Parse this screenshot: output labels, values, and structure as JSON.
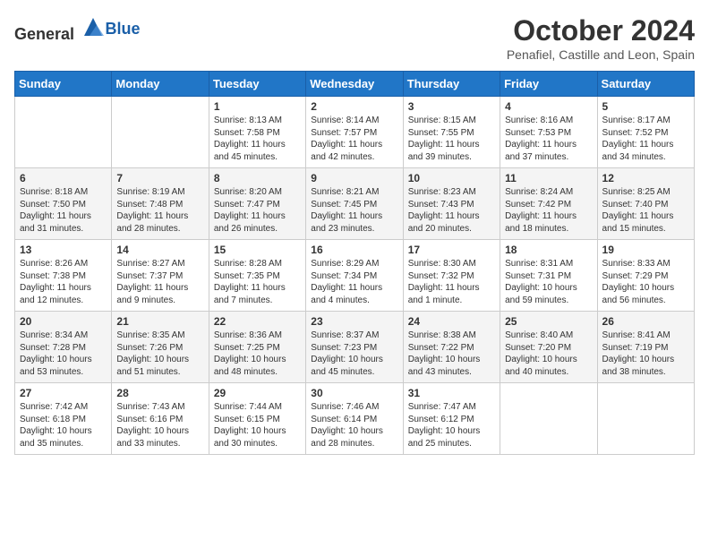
{
  "header": {
    "logo_general": "General",
    "logo_blue": "Blue",
    "main_title": "October 2024",
    "subtitle": "Penafiel, Castille and Leon, Spain"
  },
  "calendar": {
    "days_of_week": [
      "Sunday",
      "Monday",
      "Tuesday",
      "Wednesday",
      "Thursday",
      "Friday",
      "Saturday"
    ],
    "weeks": [
      [
        {
          "day": "",
          "content": ""
        },
        {
          "day": "",
          "content": ""
        },
        {
          "day": "1",
          "content": "Sunrise: 8:13 AM\nSunset: 7:58 PM\nDaylight: 11 hours and 45 minutes."
        },
        {
          "day": "2",
          "content": "Sunrise: 8:14 AM\nSunset: 7:57 PM\nDaylight: 11 hours and 42 minutes."
        },
        {
          "day": "3",
          "content": "Sunrise: 8:15 AM\nSunset: 7:55 PM\nDaylight: 11 hours and 39 minutes."
        },
        {
          "day": "4",
          "content": "Sunrise: 8:16 AM\nSunset: 7:53 PM\nDaylight: 11 hours and 37 minutes."
        },
        {
          "day": "5",
          "content": "Sunrise: 8:17 AM\nSunset: 7:52 PM\nDaylight: 11 hours and 34 minutes."
        }
      ],
      [
        {
          "day": "6",
          "content": "Sunrise: 8:18 AM\nSunset: 7:50 PM\nDaylight: 11 hours and 31 minutes."
        },
        {
          "day": "7",
          "content": "Sunrise: 8:19 AM\nSunset: 7:48 PM\nDaylight: 11 hours and 28 minutes."
        },
        {
          "day": "8",
          "content": "Sunrise: 8:20 AM\nSunset: 7:47 PM\nDaylight: 11 hours and 26 minutes."
        },
        {
          "day": "9",
          "content": "Sunrise: 8:21 AM\nSunset: 7:45 PM\nDaylight: 11 hours and 23 minutes."
        },
        {
          "day": "10",
          "content": "Sunrise: 8:23 AM\nSunset: 7:43 PM\nDaylight: 11 hours and 20 minutes."
        },
        {
          "day": "11",
          "content": "Sunrise: 8:24 AM\nSunset: 7:42 PM\nDaylight: 11 hours and 18 minutes."
        },
        {
          "day": "12",
          "content": "Sunrise: 8:25 AM\nSunset: 7:40 PM\nDaylight: 11 hours and 15 minutes."
        }
      ],
      [
        {
          "day": "13",
          "content": "Sunrise: 8:26 AM\nSunset: 7:38 PM\nDaylight: 11 hours and 12 minutes."
        },
        {
          "day": "14",
          "content": "Sunrise: 8:27 AM\nSunset: 7:37 PM\nDaylight: 11 hours and 9 minutes."
        },
        {
          "day": "15",
          "content": "Sunrise: 8:28 AM\nSunset: 7:35 PM\nDaylight: 11 hours and 7 minutes."
        },
        {
          "day": "16",
          "content": "Sunrise: 8:29 AM\nSunset: 7:34 PM\nDaylight: 11 hours and 4 minutes."
        },
        {
          "day": "17",
          "content": "Sunrise: 8:30 AM\nSunset: 7:32 PM\nDaylight: 11 hours and 1 minute."
        },
        {
          "day": "18",
          "content": "Sunrise: 8:31 AM\nSunset: 7:31 PM\nDaylight: 10 hours and 59 minutes."
        },
        {
          "day": "19",
          "content": "Sunrise: 8:33 AM\nSunset: 7:29 PM\nDaylight: 10 hours and 56 minutes."
        }
      ],
      [
        {
          "day": "20",
          "content": "Sunrise: 8:34 AM\nSunset: 7:28 PM\nDaylight: 10 hours and 53 minutes."
        },
        {
          "day": "21",
          "content": "Sunrise: 8:35 AM\nSunset: 7:26 PM\nDaylight: 10 hours and 51 minutes."
        },
        {
          "day": "22",
          "content": "Sunrise: 8:36 AM\nSunset: 7:25 PM\nDaylight: 10 hours and 48 minutes."
        },
        {
          "day": "23",
          "content": "Sunrise: 8:37 AM\nSunset: 7:23 PM\nDaylight: 10 hours and 45 minutes."
        },
        {
          "day": "24",
          "content": "Sunrise: 8:38 AM\nSunset: 7:22 PM\nDaylight: 10 hours and 43 minutes."
        },
        {
          "day": "25",
          "content": "Sunrise: 8:40 AM\nSunset: 7:20 PM\nDaylight: 10 hours and 40 minutes."
        },
        {
          "day": "26",
          "content": "Sunrise: 8:41 AM\nSunset: 7:19 PM\nDaylight: 10 hours and 38 minutes."
        }
      ],
      [
        {
          "day": "27",
          "content": "Sunrise: 7:42 AM\nSunset: 6:18 PM\nDaylight: 10 hours and 35 minutes."
        },
        {
          "day": "28",
          "content": "Sunrise: 7:43 AM\nSunset: 6:16 PM\nDaylight: 10 hours and 33 minutes."
        },
        {
          "day": "29",
          "content": "Sunrise: 7:44 AM\nSunset: 6:15 PM\nDaylight: 10 hours and 30 minutes."
        },
        {
          "day": "30",
          "content": "Sunrise: 7:46 AM\nSunset: 6:14 PM\nDaylight: 10 hours and 28 minutes."
        },
        {
          "day": "31",
          "content": "Sunrise: 7:47 AM\nSunset: 6:12 PM\nDaylight: 10 hours and 25 minutes."
        },
        {
          "day": "",
          "content": ""
        },
        {
          "day": "",
          "content": ""
        }
      ]
    ]
  }
}
